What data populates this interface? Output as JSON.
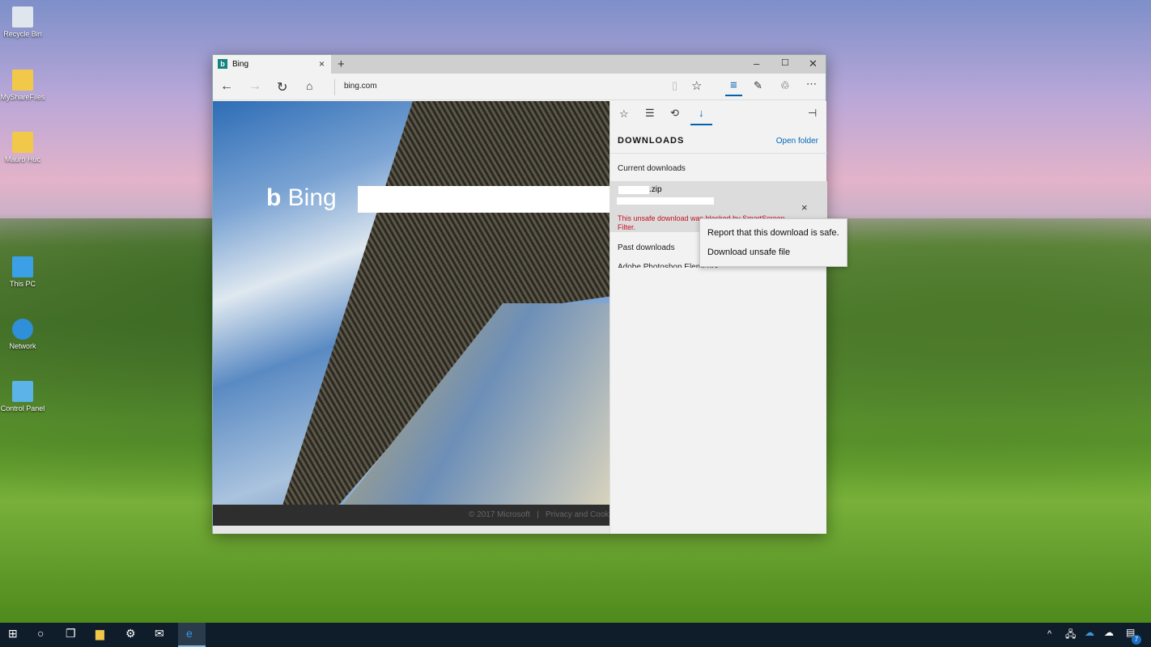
{
  "desktop": {
    "icons": [
      {
        "label": "Recycle Bin"
      },
      {
        "label": "MyShareFiles"
      },
      {
        "label": "Mauro Huc"
      },
      {
        "label": "This PC"
      },
      {
        "label": "Network"
      },
      {
        "label": "Control Panel"
      }
    ]
  },
  "browser": {
    "tab_title": "Bing",
    "url": "bing.com",
    "page": {
      "logo": "Bing",
      "footer_copyright": "© 2017 Microsoft",
      "footer_privacy": "Privacy and Cook"
    },
    "hub": {
      "title": "DOWNLOADS",
      "open_folder": "Open folder",
      "current_label": "Current downloads",
      "file_name": ".zip",
      "blocked_message": "This unsafe download was blocked by SmartScreen Filter.",
      "past_label": "Past downloads",
      "past_item": "Adobe Photoshop Elements"
    },
    "context_menu": [
      "Report that this download is safe.",
      "Download unsafe file"
    ]
  },
  "taskbar": {
    "notification_count": "7"
  },
  "colors": {
    "accent": "#0063b1",
    "error": "#c50f1f",
    "link": "#0067b8"
  }
}
